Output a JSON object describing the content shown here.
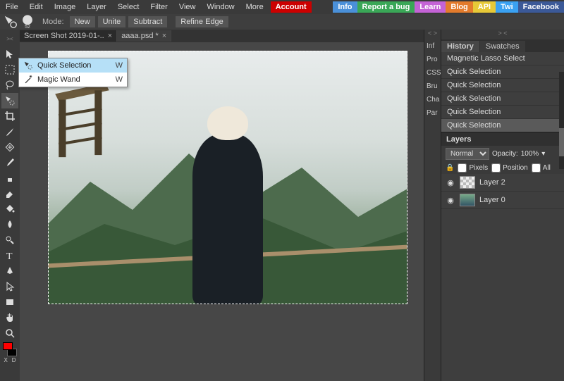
{
  "menu": {
    "items": [
      "File",
      "Edit",
      "Image",
      "Layer",
      "Select",
      "Filter",
      "View",
      "Window",
      "More"
    ],
    "account": "Account",
    "ext": [
      {
        "label": "Info",
        "color": "#4a90d9"
      },
      {
        "label": "Report a bug",
        "color": "#3aa757"
      },
      {
        "label": "Learn",
        "color": "#c463d6"
      },
      {
        "label": "Blog",
        "color": "#e37b2c"
      },
      {
        "label": "API",
        "color": "#e7c938"
      },
      {
        "label": "Twi",
        "color": "#3aa1f2"
      },
      {
        "label": "Facebook",
        "color": "#3b5998"
      }
    ]
  },
  "optbar": {
    "brush_size": "52",
    "mode_label": "Mode:",
    "modes": [
      "New",
      "Unite",
      "Subtract"
    ],
    "refine": "Refine Edge"
  },
  "tabs": {
    "items": [
      {
        "label": "Screen Shot 2019-01-..",
        "active": false
      },
      {
        "label": "aaaa.psd *",
        "active": true
      }
    ]
  },
  "flyout": {
    "items": [
      {
        "label": "Quick Selection",
        "key": "W",
        "hover": true,
        "icon": "quick-select"
      },
      {
        "label": "Magic Wand",
        "key": "W",
        "hover": false,
        "icon": "magic-wand"
      }
    ]
  },
  "sidecollapse": {
    "chev": "< >",
    "stubs": [
      "Inf",
      "Pro",
      "CSS",
      "Bru",
      "Cha",
      "Par"
    ]
  },
  "history_panel": {
    "chev": "> <",
    "tabs": [
      "History",
      "Swatches"
    ],
    "active_tab": "History",
    "rows": [
      "Magnetic Lasso Select",
      "Quick Selection",
      "Quick Selection",
      "Quick Selection",
      "Quick Selection",
      "Quick Selection"
    ],
    "selected_row": 5
  },
  "layers_panel": {
    "title": "Layers",
    "blend": "Normal",
    "opacity_label": "Opacity:",
    "opacity_value": "100%",
    "lock_icon": "🔒",
    "locks": [
      "Pixels",
      "Position",
      "All"
    ],
    "layers": [
      {
        "name": "Layer 2",
        "visible": true,
        "thumb": "checker"
      },
      {
        "name": "Layer 0",
        "visible": true,
        "thumb": "pic"
      }
    ]
  },
  "colors": {
    "fg": "#ff0000",
    "bg": "#000000"
  },
  "swap_labels": [
    "X",
    "D"
  ]
}
